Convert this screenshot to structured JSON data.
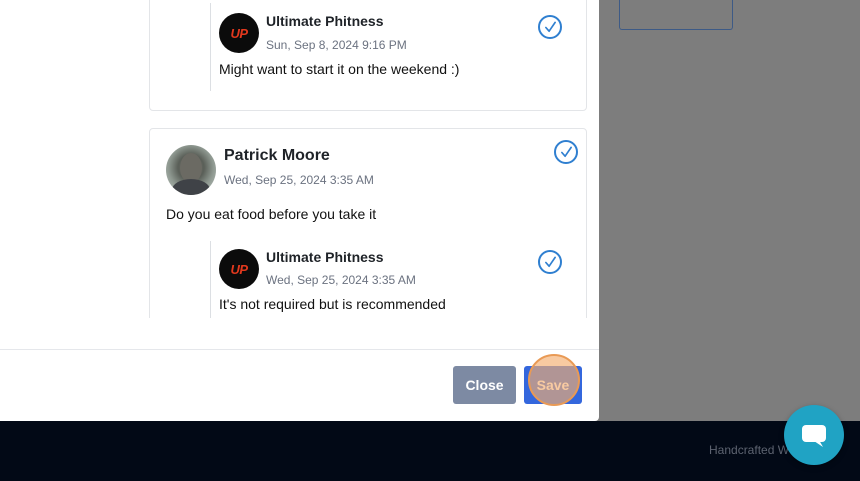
{
  "comments": [
    {
      "reply": {
        "author": "Ultimate Phitness",
        "date": "Sun, Sep 8, 2024 9:16 PM",
        "text": "Might want to start it on the weekend :)",
        "logo": "UP"
      }
    },
    {
      "author": "Patrick Moore",
      "date": "Wed, Sep 25, 2024 3:35 AM",
      "text": "Do you eat food before you take it",
      "reply": {
        "author": "Ultimate Phitness",
        "date": "Wed, Sep 25, 2024 3:35 AM",
        "text": "It's not required but is recommended",
        "logo": "UP"
      }
    }
  ],
  "footer": {
    "buttons": {
      "close": "Close",
      "save": "Save"
    }
  },
  "page_footer": {
    "text": "Handcrafted W"
  },
  "icons": {
    "check": "check-circle-icon",
    "chat": "chat-bubble-icon"
  },
  "colors": {
    "accent": "#2f7fd0",
    "save": "#3467dd",
    "close": "#7d8aa3",
    "chat": "#20a3c4"
  }
}
